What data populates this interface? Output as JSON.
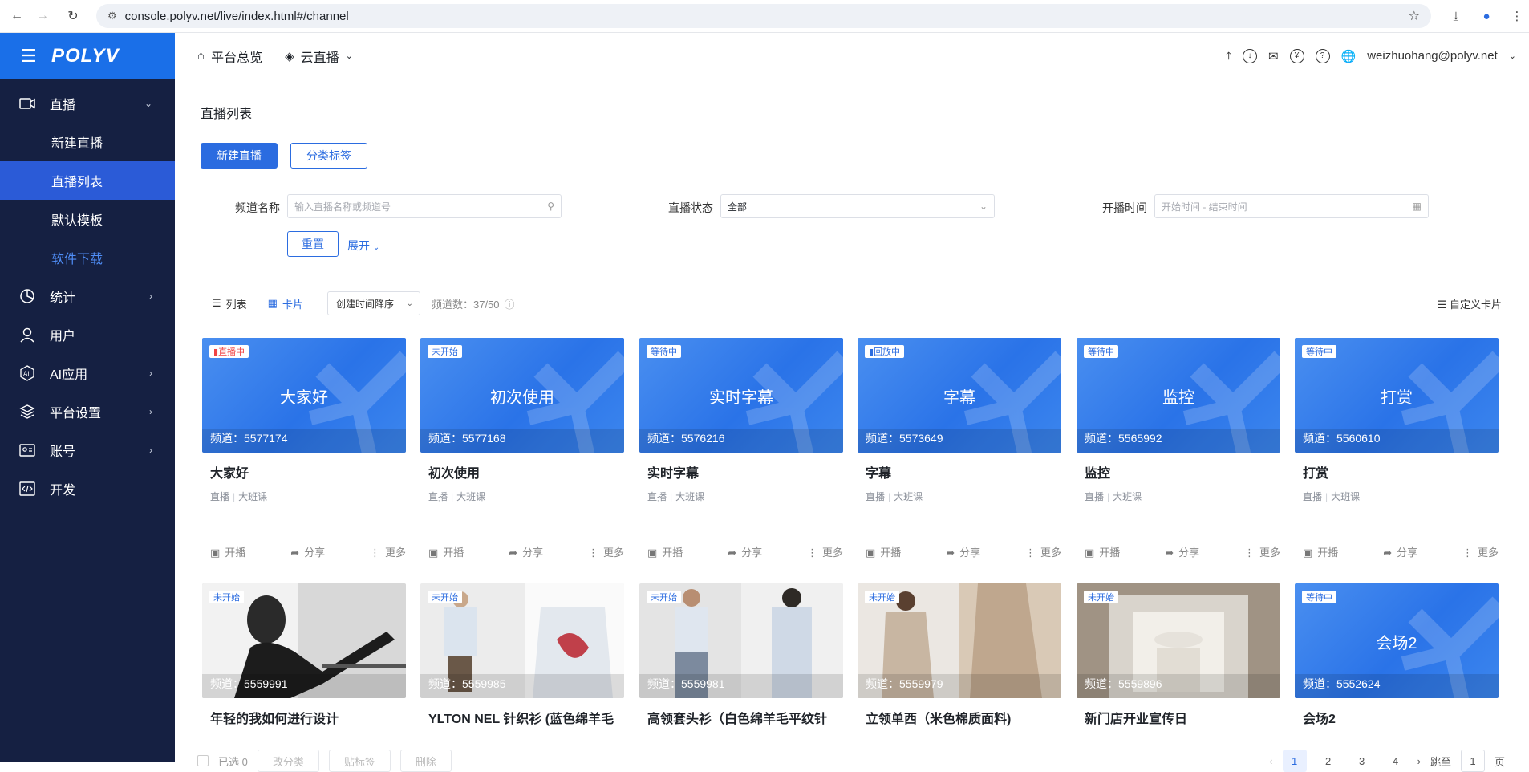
{
  "browser": {
    "url": "console.polyv.net/live/index.html#/channel"
  },
  "sidebar": {
    "logo": "POLYV",
    "items": [
      {
        "label": "直播",
        "icon": "video-icon",
        "arrow": "chevron-down"
      },
      {
        "label": "统计",
        "icon": "chart-icon",
        "arrow": "chevron-right"
      },
      {
        "label": "用户",
        "icon": "user-icon",
        "arrow": ""
      },
      {
        "label": "AI应用",
        "icon": "ai-icon",
        "arrow": "chevron-right"
      },
      {
        "label": "平台设置",
        "icon": "layers-icon",
        "arrow": "chevron-right"
      },
      {
        "label": "账号",
        "icon": "id-card-icon",
        "arrow": "chevron-right"
      },
      {
        "label": "开发",
        "icon": "code-icon",
        "arrow": ""
      }
    ],
    "sub_items": [
      {
        "label": "新建直播"
      },
      {
        "label": "直播列表"
      },
      {
        "label": "默认模板"
      },
      {
        "label": "软件下载"
      }
    ]
  },
  "topbar": {
    "nav1": "平台总览",
    "nav2": "云直播",
    "user": "weizhuohang@polyv.net"
  },
  "page": {
    "title": "直播列表",
    "new_button": "新建直播",
    "tag_button": "分类标签",
    "filters": {
      "name_label": "频道名称",
      "name_placeholder": "输入直播名称或频道号",
      "status_label": "直播状态",
      "status_value": "全部",
      "time_label": "开播时间",
      "time_placeholder": "开始时间 - 结束时间"
    },
    "reset": "重置",
    "expand": "展开",
    "view_list": "列表",
    "view_card": "卡片",
    "sort": "创建时间降序",
    "count": "频道数：37/50",
    "custom_card": "自定义卡片"
  },
  "cards": [
    {
      "badge": "直播中",
      "status": "live",
      "center": "大家好",
      "channel": "频道：5577174",
      "title": "大家好",
      "tag1": "直播",
      "tag2": "大班课"
    },
    {
      "badge": "未开始",
      "status": "ns",
      "center": "初次使用",
      "channel": "频道：5577168",
      "title": "初次使用",
      "tag1": "直播",
      "tag2": "大班课"
    },
    {
      "badge": "等待中",
      "status": "wait",
      "center": "实时字幕",
      "channel": "频道：5576216",
      "title": "实时字幕",
      "tag1": "直播",
      "tag2": "大班课"
    },
    {
      "badge": "回放中",
      "status": "rp",
      "center": "字幕",
      "channel": "频道：5573649",
      "title": "字幕",
      "tag1": "直播",
      "tag2": "大班课"
    },
    {
      "badge": "等待中",
      "status": "wait",
      "center": "监控",
      "channel": "频道：5565992",
      "title": "监控",
      "tag1": "直播",
      "tag2": "大班课"
    },
    {
      "badge": "等待中",
      "status": "wait",
      "center": "打赏",
      "channel": "频道：5560610",
      "title": "打赏",
      "tag1": "直播",
      "tag2": "大班课"
    }
  ],
  "cards2": [
    {
      "badge": "未开始",
      "channel": "频道：5559991",
      "title": "年轻的我如何进行设计",
      "photo": "designer"
    },
    {
      "badge": "未开始",
      "channel": "频道：5559985",
      "title": "YLTON NEL 针织衫 (蓝色绵羊毛",
      "photo": "knit"
    },
    {
      "badge": "未开始",
      "channel": "频道：5559981",
      "title": "高领套头衫（白色绵羊毛平纹针",
      "photo": "shirt"
    },
    {
      "badge": "未开始",
      "channel": "频道：5559979",
      "title": "立领单西（米色棉质面料)",
      "photo": "suit"
    },
    {
      "badge": "未开始",
      "channel": "频道：5559896",
      "title": "新门店开业宣传日",
      "photo": "store"
    },
    {
      "badge": "等待中",
      "channel": "频道：5552624",
      "title": "会场2",
      "center": "会场2",
      "photo": ""
    }
  ],
  "actions": {
    "start": "开播",
    "share": "分享",
    "more": "更多"
  },
  "bottom": {
    "selected": "已选 0",
    "btn1": "改分类",
    "btn2": "贴标签",
    "btn3": "删除",
    "pages": [
      "1",
      "2",
      "3",
      "4"
    ],
    "goto": "跳至",
    "page_input": "1",
    "page_unit": "页"
  }
}
